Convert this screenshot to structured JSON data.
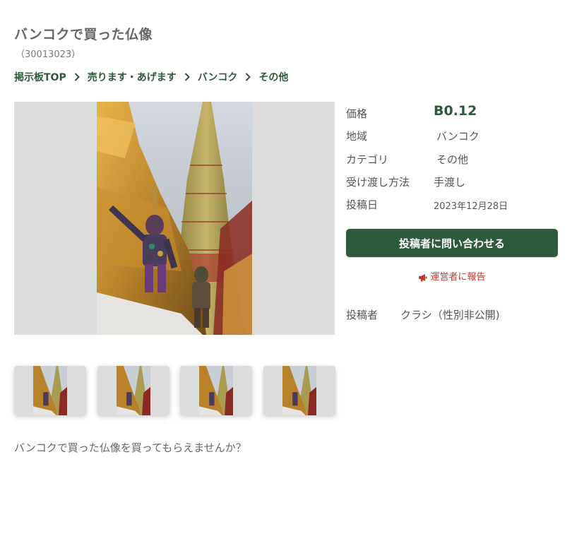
{
  "title": "バンコクで買った仏像",
  "post_id": "（30013023）",
  "breadcrumb": [
    {
      "label": "掲示板TOP"
    },
    {
      "label": "売ります・あげます"
    },
    {
      "label": "バンコク"
    },
    {
      "label": "その他"
    }
  ],
  "details": {
    "price_label": "価格",
    "price_value": "B0.12",
    "region_label": "地域",
    "region_value": "バンコク",
    "category_label": "カテゴリ",
    "category_value": "その他",
    "delivery_label": "受け渡し方法",
    "delivery_value": "手渡し",
    "date_label": "投稿日",
    "date_value": "2023年12月28日"
  },
  "contact_button": "投稿者に問い合わせる",
  "report_link": "運営者に報告",
  "poster": {
    "label": "投稿者",
    "name": "クラシ（性別非公開)"
  },
  "description": "バンコクで買った仏像を買ってもらえませんか？",
  "colors": {
    "accent": "#2d5a3d",
    "report": "#c0392b",
    "image_bg": "#dcdcdc"
  }
}
